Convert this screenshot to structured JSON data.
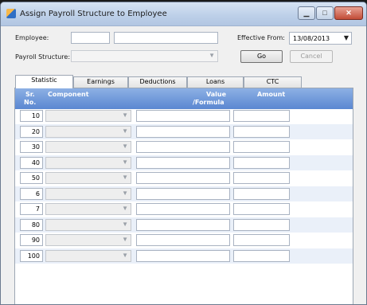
{
  "window": {
    "title": "Assign Payroll Structure to Employee",
    "controls": {
      "minimize": "▁",
      "maximize": "□",
      "close": "✕"
    }
  },
  "form": {
    "employee_label": "Employee:",
    "employee_code": "",
    "employee_name": "",
    "effective_from_label": "Effective From:",
    "effective_from_value": "13/08/2013",
    "payroll_structure_label": "Payroll Structure:",
    "payroll_structure_value": "",
    "go_label": "Go",
    "cancel_label": "Cancel"
  },
  "tabs": [
    "Statistic",
    "Earnings",
    "Deductions",
    "Loans",
    "CTC"
  ],
  "grid": {
    "headers": {
      "sr_line1": "Sr.",
      "sr_line2": "No.",
      "component": "Component",
      "value_line1": "Value",
      "value_line2": "/Formula",
      "amount": "Amount"
    },
    "rows": [
      {
        "sr": "10"
      },
      {
        "sr": "20"
      },
      {
        "sr": "30"
      },
      {
        "sr": "40"
      },
      {
        "sr": "50"
      },
      {
        "sr": "6"
      },
      {
        "sr": "7"
      },
      {
        "sr": "80"
      },
      {
        "sr": "90"
      },
      {
        "sr": "100"
      }
    ]
  }
}
